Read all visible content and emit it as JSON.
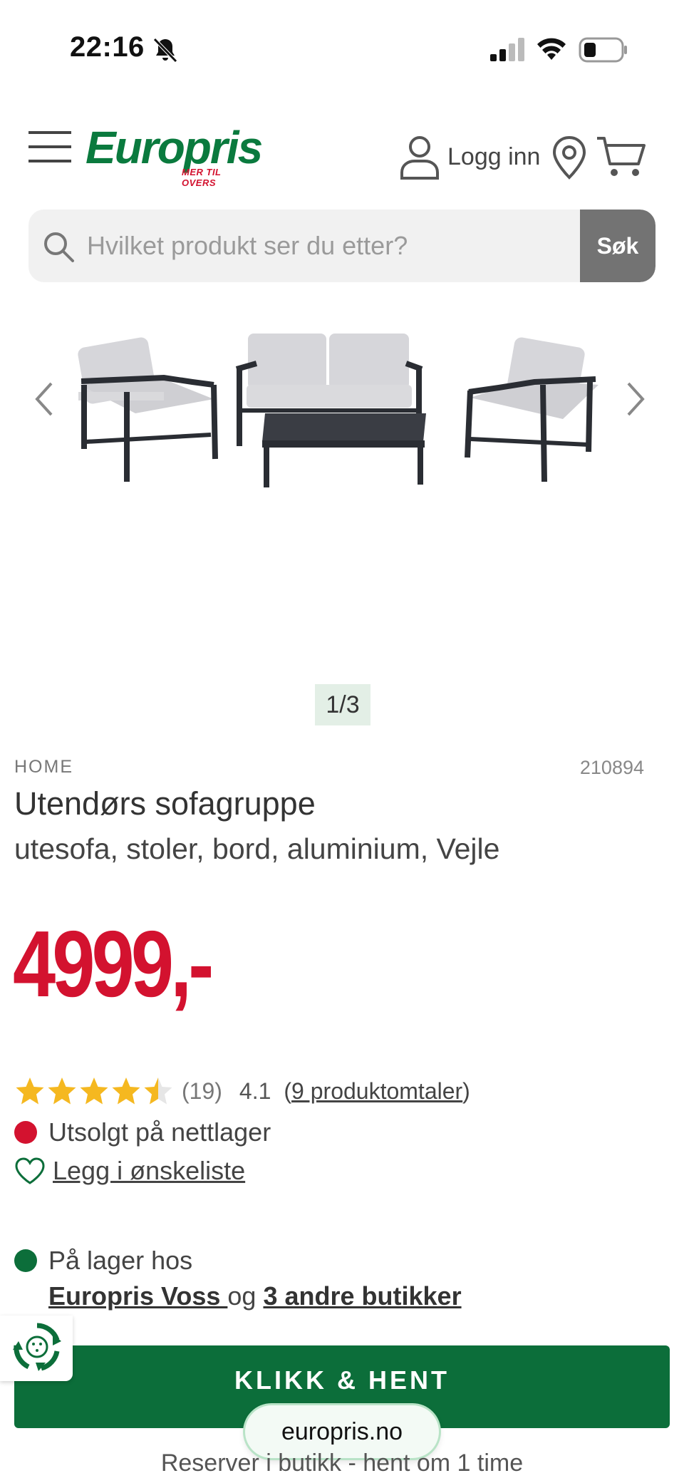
{
  "status_bar": {
    "time": "22:16",
    "icons": [
      "bell-slash-icon",
      "cellular-signal-icon",
      "wifi-icon",
      "battery-icon"
    ]
  },
  "header": {
    "logo_text": "Europris",
    "logo_tagline": "MER TIL OVERS",
    "login_label": "Logg inn",
    "icons": [
      "menu-icon",
      "user-icon",
      "location-pin-icon",
      "cart-icon"
    ]
  },
  "search": {
    "placeholder": "Hvilket produkt ser du etter?",
    "button_label": "Søk"
  },
  "gallery": {
    "pager": "1/3"
  },
  "product": {
    "brand": "HOME",
    "sku": "210894",
    "title": "Utendørs sofagruppe",
    "subtitle": "utesofa, stoler, bord, aluminium, Vejle",
    "price": "4999,-",
    "rating_stars": 4.5,
    "rating_count": "(19)",
    "rating_average": "4.1",
    "reviews_prefix": "(",
    "reviews_link": "9 produktomtaler",
    "reviews_suffix": ")"
  },
  "availability": {
    "online_status": "Utsolgt på nettlager",
    "wishlist_label": "Legg i ønskeliste",
    "store_status": "På lager hos",
    "store_name": "Europris Voss ",
    "store_connector": "og",
    "other_stores": "3 andre butikker"
  },
  "cta": {
    "button_label": "KLIKK & HENT",
    "note": "Reserver i butikk - hent om 1 time"
  },
  "browser": {
    "url": "europris.no"
  },
  "colors": {
    "brand_green": "#0c6e3a",
    "price_red": "#d3122f",
    "status_red": "#d3122f",
    "status_green": "#0c6e3a",
    "star_gold": "#f5b820"
  }
}
